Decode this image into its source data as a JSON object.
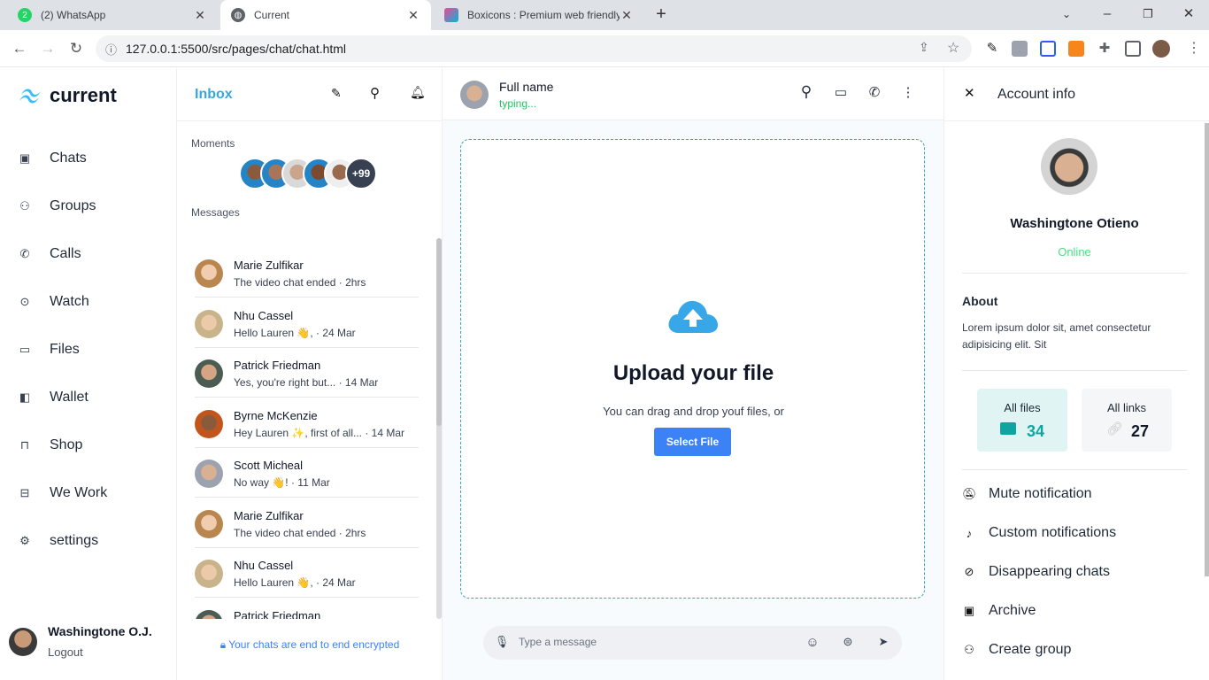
{
  "browser": {
    "tabs": [
      {
        "title": "(2) WhatsApp",
        "favicon": "whatsapp-icon",
        "active": false
      },
      {
        "title": "Current",
        "favicon": "globe-icon",
        "active": true
      },
      {
        "title": "Boxicons : Premium web friendly",
        "favicon": "boxicons-icon",
        "active": false
      }
    ],
    "url": "127.0.0.1:5500/src/pages/chat/chat.html"
  },
  "sidebar": {
    "brand": "current",
    "items": [
      {
        "label": "Chats",
        "icon": "chat-icon"
      },
      {
        "label": "Groups",
        "icon": "group-icon"
      },
      {
        "label": "Calls",
        "icon": "phone-icon"
      },
      {
        "label": "Watch",
        "icon": "play-icon"
      },
      {
        "label": "Files",
        "icon": "folder-icon"
      },
      {
        "label": "Wallet",
        "icon": "wallet-icon"
      },
      {
        "label": "Shop",
        "icon": "shopping-bag-icon"
      },
      {
        "label": "We Work",
        "icon": "briefcase-icon"
      },
      {
        "label": "settings",
        "icon": "gear-icon"
      }
    ],
    "user": {
      "name": "Washingtone O.J.",
      "logout": "Logout"
    }
  },
  "inbox": {
    "title": "Inbox",
    "moments_label": "Moments",
    "moments_more": "+99",
    "messages_label": "Messages",
    "messages": [
      {
        "name": "Marie Zulfikar",
        "preview": "The video chat ended · 2hrs"
      },
      {
        "name": "Nhu Cassel",
        "preview": "Hello Lauren 👋, · 24 Mar"
      },
      {
        "name": "Patrick Friedman",
        "preview": "Yes, you're right but... · 14 Mar"
      },
      {
        "name": "Byrne McKenzie",
        "preview": "Hey Lauren ✨, first of all... · 14 Mar"
      },
      {
        "name": "Scott Micheal",
        "preview": "No way 👋! · 11 Mar"
      },
      {
        "name": "Marie Zulfikar",
        "preview": "The video chat ended · 2hrs"
      },
      {
        "name": "Nhu Cassel",
        "preview": "Hello Lauren 👋, · 24 Mar"
      },
      {
        "name": "Patrick Friedman",
        "preview": ""
      }
    ],
    "encrypted_note": "Your chats are end to end encrypted"
  },
  "chat": {
    "contact_name": "Full name",
    "status": "typing...",
    "upload_title": "Upload your file",
    "upload_sub": "You can drag and drop youf files, or",
    "upload_button": "Select File",
    "composer_placeholder": "Type a message"
  },
  "account": {
    "title": "Account info",
    "name": "Washingtone Otieno",
    "status": "Online",
    "about_label": "About",
    "about_text": "Lorem ipsum dolor sit, amet consectetur adipisicing elit. Sit",
    "files_label": "All files",
    "files_count": "34",
    "links_label": "All links",
    "links_count": "27",
    "actions": [
      {
        "label": "Mute notification",
        "icon": "bell-off-icon"
      },
      {
        "label": "Custom notifications",
        "icon": "tiktok-icon"
      },
      {
        "label": "Disappearing chats",
        "icon": "eye-off-icon"
      },
      {
        "label": "Archive",
        "icon": "archive-icon"
      },
      {
        "label": "Create group",
        "icon": "user-plus-icon"
      }
    ]
  },
  "colors": {
    "accent": "#3b82f6",
    "online": "#4ade80",
    "typing": "#22c55e",
    "files_card": "#e0f5f3",
    "files_accent": "#0ea5a0"
  }
}
